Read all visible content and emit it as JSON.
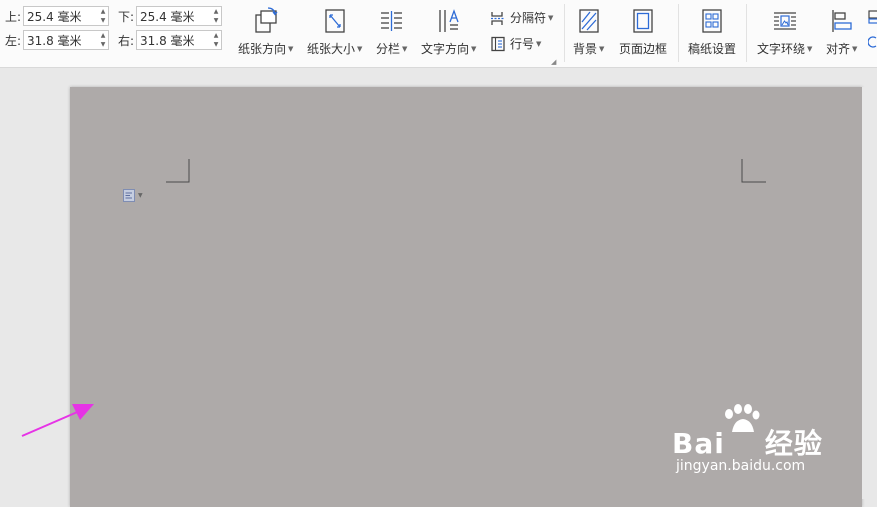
{
  "margins": {
    "top_label": "上:",
    "top_value": "25.4 毫米",
    "bottom_label": "下:",
    "bottom_value": "25.4 毫米",
    "left_label": "左:",
    "left_value": "31.8 毫米",
    "right_label": "右:",
    "right_value": "31.8 毫米"
  },
  "toolbar": {
    "orientation_label": "纸张方向",
    "size_label": "纸张大小",
    "columns_label": "分栏",
    "text_direction_label": "文字方向",
    "separator_label": "分隔符",
    "line_number_label": "行号",
    "background_label": "背景",
    "page_border_label": "页面边框",
    "manuscript_label": "稿纸设置",
    "text_wrap_label": "文字环绕",
    "align_label": "对齐"
  },
  "watermark": {
    "brand": "Bai",
    "brand_cn": "经验",
    "url": "jingyan.baidu.com"
  },
  "colors": {
    "page_background": "#aeaaa9",
    "annotation_arrow": "#e633e6",
    "icon_accent": "#2d6bd6"
  }
}
